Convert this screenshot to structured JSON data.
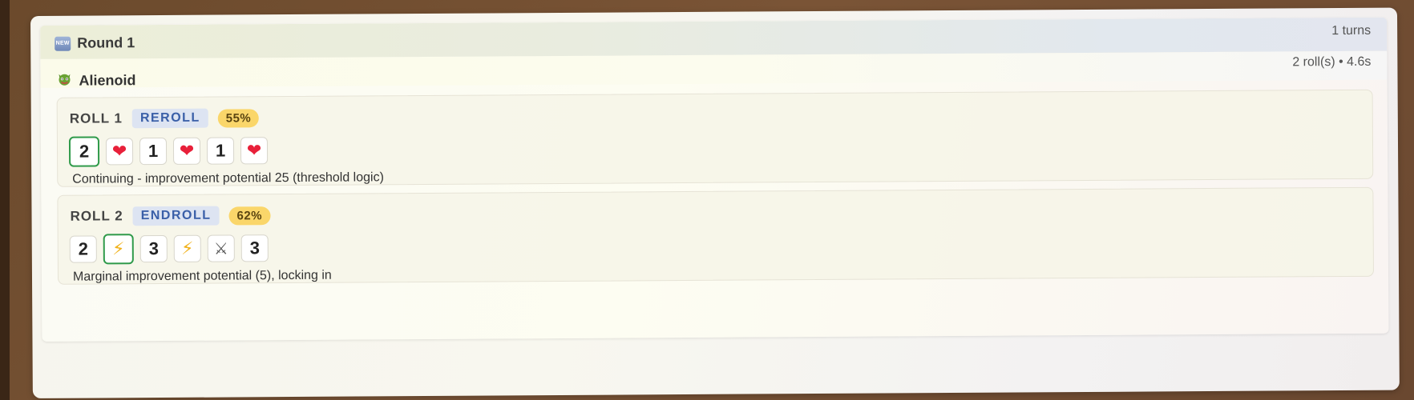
{
  "round": {
    "icon": "new-icon",
    "icon_text": "NEW",
    "title": "Round 1",
    "turns": "1 turns"
  },
  "player": {
    "icon": "monster-face-icon",
    "name": "Alienoid",
    "meta": "2 roll(s) • 4.6s"
  },
  "rolls": [
    {
      "label": "ROLL 1",
      "tag": "REROLL",
      "pct": "55%",
      "dice": [
        {
          "face": "2",
          "type": "number",
          "locked": true
        },
        {
          "face": "heart",
          "type": "icon",
          "locked": false
        },
        {
          "face": "1",
          "type": "number",
          "locked": false
        },
        {
          "face": "heart",
          "type": "icon",
          "locked": false
        },
        {
          "face": "1",
          "type": "number",
          "locked": false
        },
        {
          "face": "heart",
          "type": "icon",
          "locked": false
        }
      ],
      "reason": "Continuing - improvement potential 25 (threshold logic)"
    },
    {
      "label": "ROLL 2",
      "tag": "ENDROLL",
      "pct": "62%",
      "dice": [
        {
          "face": "2",
          "type": "number",
          "locked": false
        },
        {
          "face": "energy",
          "type": "icon",
          "locked": true
        },
        {
          "face": "3",
          "type": "number",
          "locked": false
        },
        {
          "face": "energy",
          "type": "icon",
          "locked": false
        },
        {
          "face": "claw",
          "type": "icon",
          "locked": false
        },
        {
          "face": "3",
          "type": "number",
          "locked": false
        }
      ],
      "reason": "Marginal improvement potential (5), locking in"
    }
  ],
  "colors": {
    "lock_border": "#2f9a4a",
    "tag_bg": "#dde4f2",
    "tag_text": "#3a5fa8",
    "pct_bg": "#fad66a",
    "heart": "#e8203a",
    "energy": "#f1b21c"
  }
}
